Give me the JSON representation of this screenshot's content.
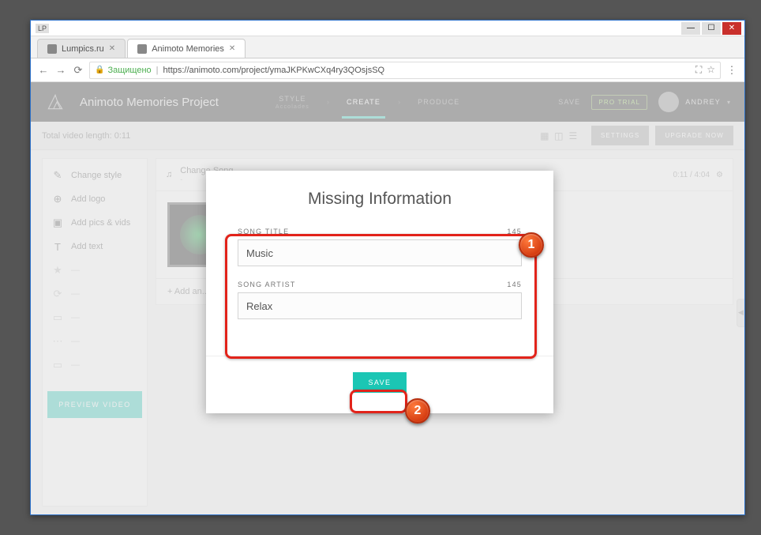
{
  "browser": {
    "tabs": [
      {
        "title": "Lumpics.ru",
        "active": false
      },
      {
        "title": "Animoto Memories",
        "active": true
      }
    ],
    "secure_label": "Защищено",
    "url": "https://animoto.com/project/ymaJKPKwCXq4ry3QOsjsSQ",
    "lp_badge": "LP"
  },
  "header": {
    "project_title": "Animoto Memories Project",
    "steps": {
      "style": "STYLE",
      "style_sub": "Accolades",
      "create": "CREATE",
      "produce": "PRODUCE"
    },
    "save": "SAVE",
    "pro_trial": "PRO TRIAL",
    "username": "ANDREY"
  },
  "subbar": {
    "length_label": "Total video length: 0:11",
    "settings": "SETTINGS",
    "upgrade": "UPGRADE NOW"
  },
  "sidebar": {
    "items": [
      {
        "label": "Change style",
        "icon": "✎"
      },
      {
        "label": "Add logo",
        "icon": "⊕"
      },
      {
        "label": "Add pics & vids",
        "icon": "▣"
      },
      {
        "label": "Add text",
        "icon": "T"
      }
    ],
    "preview": "PREVIEW VIDEO"
  },
  "song_bar": {
    "title": "Change Song",
    "sub": "-",
    "time": "0:11 / 4:04"
  },
  "add_section": "+ Add an...",
  "modal": {
    "title": "Missing Information",
    "song_title_label": "SONG TITLE",
    "song_title_count": "145",
    "song_title_value": "Music",
    "song_artist_label": "SONG ARTIST",
    "song_artist_count": "145",
    "song_artist_value": "Relax",
    "save": "SAVE"
  },
  "markers": {
    "one": "1",
    "two": "2"
  }
}
